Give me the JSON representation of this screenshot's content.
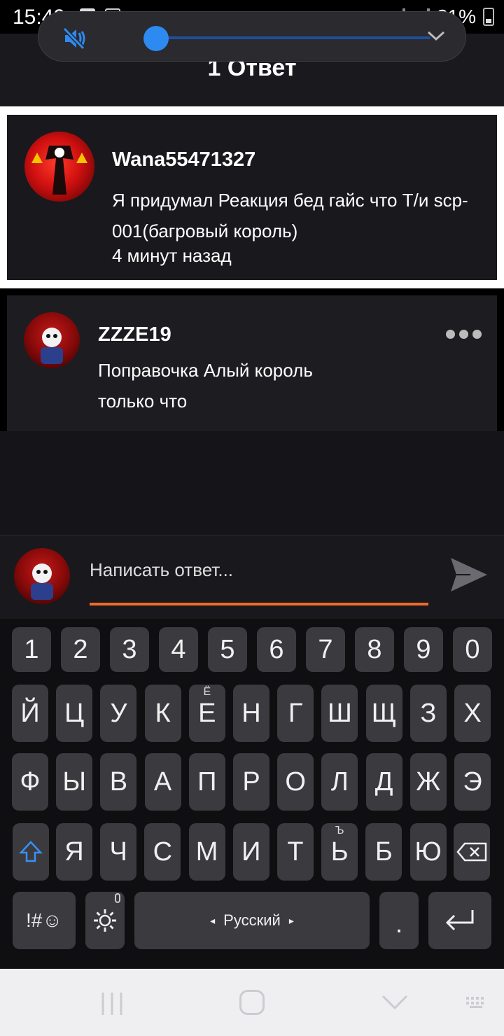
{
  "status_bar": {
    "time": "15:49",
    "battery": "31%"
  },
  "header": {
    "title": "1 Ответ"
  },
  "volume_popup": {
    "level_fraction": 0.05,
    "muted": true
  },
  "parent_comment": {
    "username": "Wana55471327",
    "text": "Я придумал Реакция бед гайс что Т/и scp-001(багровый король)",
    "time": "4 минут назад"
  },
  "reply": {
    "username": "ZZZE19",
    "text": "Поправочка Алый король",
    "time": "только что"
  },
  "composer": {
    "placeholder": "Написать ответ...",
    "accent": "#f06a28"
  },
  "keyboard": {
    "row_numbers": [
      "1",
      "2",
      "3",
      "4",
      "5",
      "6",
      "7",
      "8",
      "9",
      "0"
    ],
    "row1": [
      "Й",
      "Ц",
      "У",
      "К",
      "Е",
      "Н",
      "Г",
      "Ш",
      "Щ",
      "З",
      "Х"
    ],
    "row1_hint_e": "Ё",
    "row2": [
      "Ф",
      "Ы",
      "В",
      "А",
      "П",
      "Р",
      "О",
      "Л",
      "Д",
      "Ж",
      "Э"
    ],
    "row3": [
      "Я",
      "Ч",
      "С",
      "М",
      "И",
      "Т",
      "Ь",
      "Б",
      "Ю"
    ],
    "row3_hint_soft": "Ъ",
    "symbols_label": "!#☺",
    "language_label": "Русский",
    "period_label": "."
  }
}
